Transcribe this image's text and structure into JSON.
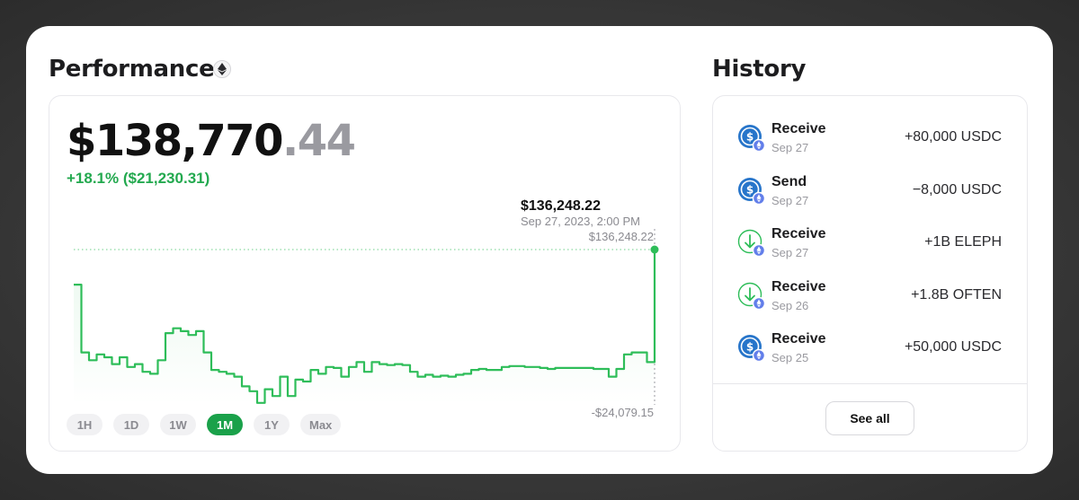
{
  "performance": {
    "title": "Performance",
    "balance_whole": "$138,770",
    "balance_decimal": ".44",
    "change": "+18.1% ($21,230.31)",
    "ranges": [
      "1H",
      "1D",
      "1W",
      "1M",
      "1Y",
      "Max"
    ],
    "active_range": "1M"
  },
  "chart_data": {
    "type": "line",
    "tooltip_value": "$136,248.22",
    "tooltip_date": "Sep 27, 2023, 2:00 PM",
    "max_label": "$136,248.22",
    "min_label": "-$24,079.15",
    "ylim": [
      -24079.15,
      136248.22
    ],
    "line_color": "#2ebd59",
    "series": [
      {
        "values": [
          100000,
          30000,
          22000,
          28000,
          25000,
          18000,
          25000,
          15000,
          18000,
          10000,
          8000,
          22000,
          50000,
          55000,
          52000,
          48000,
          52000,
          30000,
          12000,
          10000,
          8000,
          5000,
          -5000,
          -10000,
          -22000,
          -8000,
          -15000,
          5000,
          -15000,
          2000,
          0,
          12000,
          8000,
          15000,
          14000,
          5000,
          15000,
          20000,
          10000,
          20000,
          18000,
          17000,
          18000,
          17000,
          10000,
          5000,
          7000,
          5000,
          6000,
          5000,
          7000,
          8000,
          12000,
          13000,
          12000,
          12000,
          15000,
          16000,
          16000,
          15000,
          15000,
          14000,
          13000,
          14000,
          14000,
          14000,
          14000,
          14000,
          13000,
          13000,
          5000,
          13000,
          28000,
          30000,
          30000,
          20000,
          136248
        ]
      }
    ]
  },
  "history": {
    "title": "History",
    "items": [
      {
        "label": "Receive",
        "date": "Sep 27",
        "amount": "+80,000 USDC",
        "icon": "usdc-coin-icon"
      },
      {
        "label": "Send",
        "date": "Sep 27",
        "amount": "−8,000 USDC",
        "icon": "usdc-coin-icon"
      },
      {
        "label": "Receive",
        "date": "Sep 27",
        "amount": "+1B ELEPH",
        "icon": "receive-arrow-icon"
      },
      {
        "label": "Receive",
        "date": "Sep 26",
        "amount": "+1.8B OFTEN",
        "icon": "receive-arrow-icon"
      },
      {
        "label": "Receive",
        "date": "Sep 25",
        "amount": "+50,000 USDC",
        "icon": "usdc-coin-icon"
      }
    ],
    "see_all": "See all"
  },
  "colors": {
    "accent_green": "#1aa14a",
    "positive_text": "#23a94f",
    "usdc_blue": "#2775ca",
    "eth_badge": "#627eea"
  }
}
